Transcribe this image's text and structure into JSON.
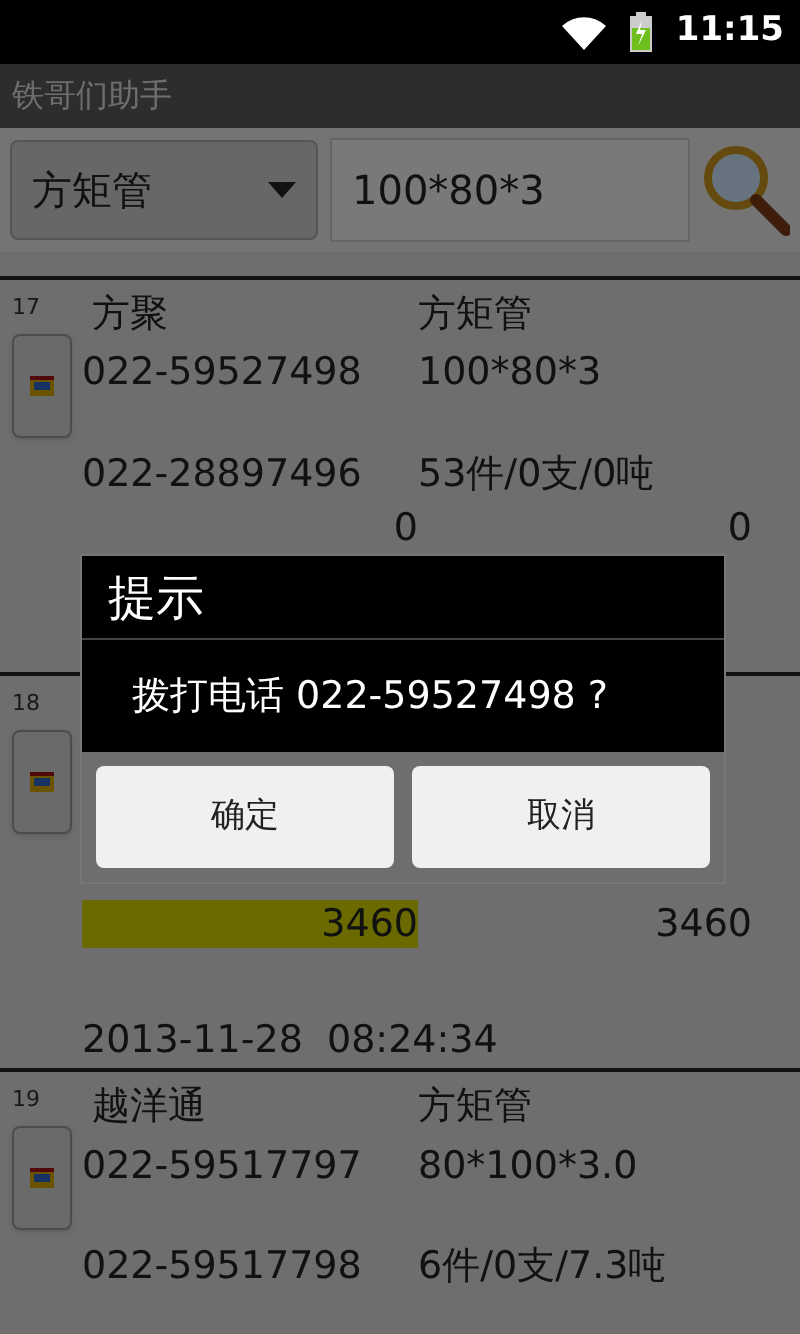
{
  "status_bar": {
    "time": "11:15"
  },
  "app_bar": {
    "title": "铁哥们助手"
  },
  "search": {
    "category": "方矩管",
    "query": "100*80*3"
  },
  "rows": [
    {
      "index": "17",
      "name": "方聚",
      "product": "方矩管",
      "phone_1": "022-59527498",
      "spec": "100*80*3",
      "phone_2": "022-28897496",
      "stock": "53件/0支/0吨",
      "price_1": "0",
      "price_1_highlighted": false,
      "price_2": "0"
    },
    {
      "index": "18",
      "price_1": "3460",
      "price_1_highlighted": true,
      "price_2": "3460",
      "date": "2013-11-28  08:24:34"
    },
    {
      "index": "19",
      "name": "越洋通",
      "product": "方矩管",
      "phone_1": "022-59517797",
      "spec": "80*100*3.0",
      "phone_2": "022-59517798",
      "stock": "6件/0支/7.3吨"
    }
  ],
  "dialog": {
    "title": "提示",
    "message": "拨打电话 022-59527498 ?",
    "buttons": [
      {
        "label": "确定"
      },
      {
        "label": "取消"
      }
    ]
  }
}
